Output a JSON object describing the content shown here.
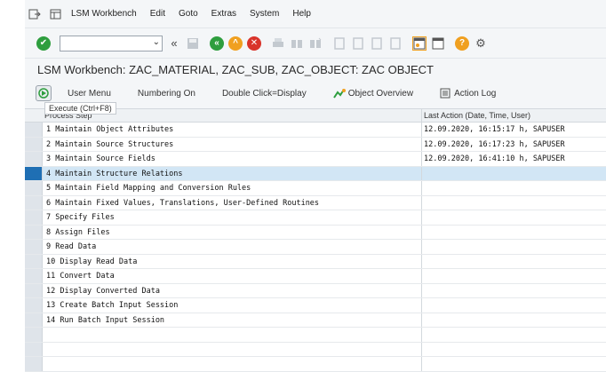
{
  "menubar": {
    "items": [
      {
        "label": "LSM Workbench"
      },
      {
        "label": "Edit"
      },
      {
        "label": "Goto"
      },
      {
        "label": "Extras"
      },
      {
        "label": "System"
      },
      {
        "label": "Help"
      }
    ]
  },
  "systoolbar": {
    "command_field_value": ""
  },
  "title": "LSM Workbench: ZAC_MATERIAL, ZAC_SUB, ZAC_OBJECT: ZAC OBJECT",
  "apptoolbar": {
    "tooltip": "Execute   (Ctrl+F8)",
    "user_menu": "User Menu",
    "numbering_on": "Numbering On",
    "double_click": "Double Click=Display",
    "object_overview": "Object Overview",
    "action_log": "Action Log"
  },
  "table": {
    "col_step": "Process Step",
    "col_last": "Last Action (Date, Time, User)",
    "rows": [
      {
        "step": "1 Maintain Object Attributes",
        "last": "12.09.2020, 16:15:17 h, SAPUSER"
      },
      {
        "step": "2 Maintain Source Structures",
        "last": "12.09.2020, 16:17:23 h, SAPUSER"
      },
      {
        "step": "3 Maintain Source Fields",
        "last": "12.09.2020, 16:41:10 h, SAPUSER"
      },
      {
        "step": "4 Maintain Structure Relations",
        "last": ""
      },
      {
        "step": "5 Maintain Field Mapping and Conversion Rules",
        "last": ""
      },
      {
        "step": "6 Maintain Fixed Values, Translations, User-Defined Routines",
        "last": ""
      },
      {
        "step": "7 Specify Files",
        "last": ""
      },
      {
        "step": "8 Assign Files",
        "last": ""
      },
      {
        "step": "9 Read Data",
        "last": ""
      },
      {
        "step": "10 Display Read Data",
        "last": ""
      },
      {
        "step": "11 Convert Data",
        "last": ""
      },
      {
        "step": "12 Display Converted Data",
        "last": ""
      },
      {
        "step": "13 Create Batch Input Session",
        "last": ""
      },
      {
        "step": "14 Run Batch Input Session",
        "last": ""
      }
    ]
  },
  "colors": {
    "selected_row": "#d2e6f5",
    "selected_marker": "#1f6fb4",
    "green": "#2e9e3e",
    "orange": "#f0a020",
    "red": "#d9342b"
  }
}
